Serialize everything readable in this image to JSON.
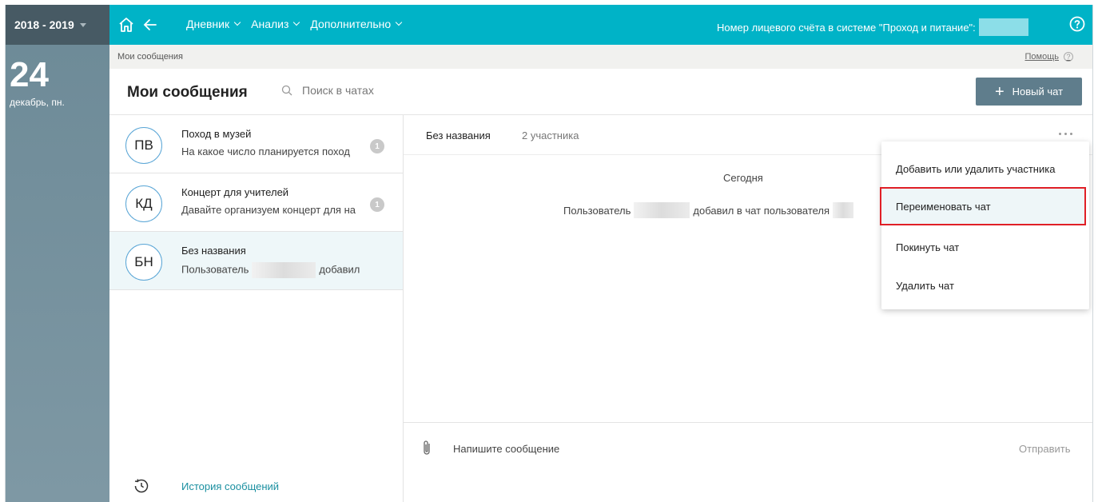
{
  "sidebar": {
    "year": "2018 - 2019",
    "day": "24",
    "month_weekday": "декабрь, пн."
  },
  "topbar": {
    "nav": [
      {
        "label": "Дневник"
      },
      {
        "label": "Анализ"
      },
      {
        "label": "Дополнительно"
      }
    ],
    "account_label": "Номер лицевого счёта в системе \"Проход и питание\":",
    "colors": {
      "bar": "#00b3c7",
      "sidebar": "#475a64"
    }
  },
  "breadcrumb": {
    "current": "Мои сообщения",
    "help": "Помощь",
    "help_mark": "?"
  },
  "header": {
    "title": "Мои сообщения",
    "search_placeholder": "Поиск в чатах",
    "new_chat_plus": "+",
    "new_chat": "Новый чат"
  },
  "chats": [
    {
      "initials": "ПВ",
      "name": "Поход в музей",
      "preview": "На какое число планируется поход",
      "unread": "1"
    },
    {
      "initials": "КД",
      "name": "Концерт для учителей",
      "preview": "Давайте организуем концерт для на",
      "unread": "1"
    },
    {
      "initials": "БН",
      "name": "Без названия",
      "preview_before": "Пользователь",
      "preview_after": "добавил",
      "active": true
    }
  ],
  "history": "История сообщений",
  "chat": {
    "name": "Без названия",
    "members": "2 участника",
    "date_divider": "Сегодня",
    "system_before": "Пользователь",
    "system_after": "добавил в чат пользователя",
    "composer_placeholder": "Напишите сообщение",
    "send": "Отправить"
  },
  "menu": {
    "items": [
      {
        "label": "Добавить или удалить участника"
      },
      {
        "label": "Переименовать чат",
        "highlighted": true
      },
      {
        "label": "Покинуть чат"
      },
      {
        "label": "Удалить чат"
      }
    ]
  }
}
